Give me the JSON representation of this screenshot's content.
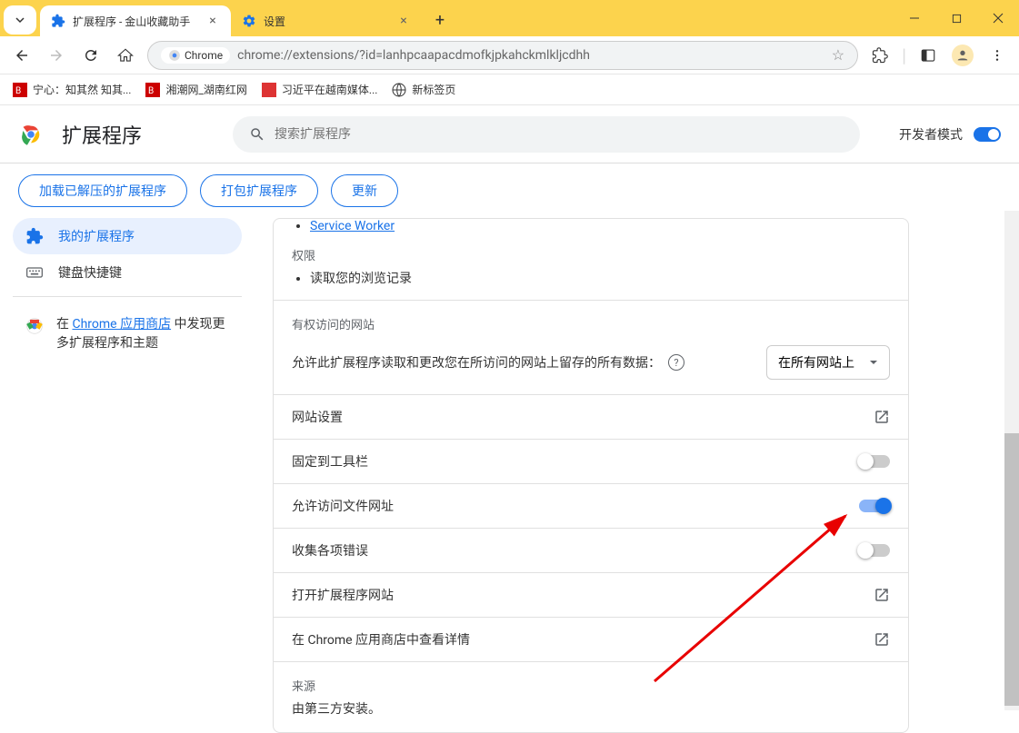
{
  "titlebar": {
    "tab1_title": "扩展程序 - 金山收藏助手",
    "tab2_title": "设置"
  },
  "addressbar": {
    "chrome_label": "Chrome",
    "url": "chrome://extensions/?id=lanhpcaapacdmofkjpkahckmlkljcdhh"
  },
  "bookmarks": [
    {
      "label": "宁心：知其然 知其...",
      "icon": "red"
    },
    {
      "label": "湘潮网_湖南红网",
      "icon": "red"
    },
    {
      "label": "习近平在越南媒体...",
      "icon": "redflag"
    },
    {
      "label": "新标签页",
      "icon": "globe"
    }
  ],
  "ext_header": {
    "title": "扩展程序",
    "search_placeholder": "搜索扩展程序",
    "dev_mode": "开发者模式"
  },
  "actions": {
    "load_unpacked": "加载已解压的扩展程序",
    "pack": "打包扩展程序",
    "update": "更新"
  },
  "sidebar": {
    "my_extensions": "我的扩展程序",
    "shortcuts": "键盘快捷键",
    "webstore_text_pre": "在 ",
    "webstore_link": "Chrome 应用商店",
    "webstore_text_post": " 中发现更多扩展程序和主题"
  },
  "detail": {
    "service_worker": "Service Worker",
    "permissions": {
      "heading": "权限",
      "item": "读取您的浏览记录"
    },
    "site_access": {
      "heading": "有权访问的网站",
      "text": "允许此扩展程序读取和更改您在所访问的网站上留存的所有数据：",
      "dropdown_value": "在所有网站上"
    },
    "website_settings": "网站设置",
    "pin_to_toolbar": "固定到工具栏",
    "allow_file_urls": "允许访问文件网址",
    "collect_errors": "收集各项错误",
    "open_ext_website": "打开扩展程序网站",
    "view_in_webstore": "在 Chrome 应用商店中查看详情",
    "source": {
      "heading": "来源",
      "text": "由第三方安装。"
    }
  }
}
